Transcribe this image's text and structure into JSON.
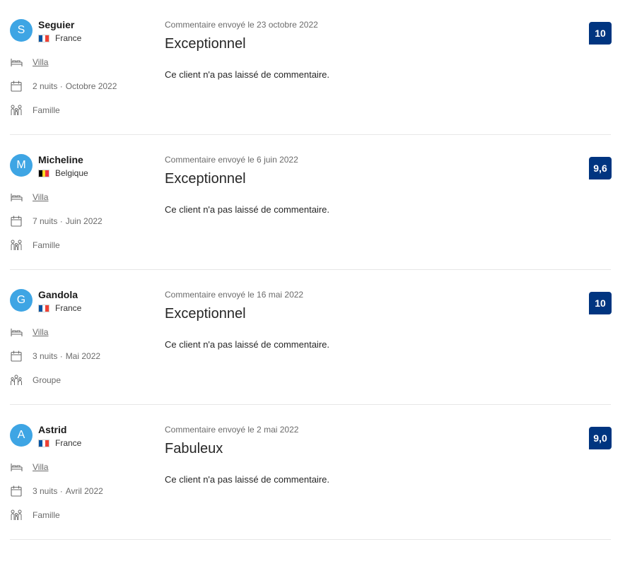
{
  "reviews": [
    {
      "initial": "S",
      "name": "Seguier",
      "country": "France",
      "room": "Villa",
      "nights": "2 nuits ·",
      "month": "Octobre 2022",
      "traveler_type": "Famille",
      "date": "Commentaire envoyé le 23 octobre 2022",
      "title": "Exceptionnel",
      "body": "Ce client n'a pas laissé de commentaire.",
      "score": "10",
      "flag_colors": [
        "#0055a4",
        "#ffffff",
        "#ef4135"
      ]
    },
    {
      "initial": "M",
      "name": "Micheline",
      "country": "Belgique",
      "room": "Villa",
      "nights": "7 nuits ·",
      "month": "Juin 2022",
      "traveler_type": "Famille",
      "date": "Commentaire envoyé le 6 juin 2022",
      "title": "Exceptionnel",
      "body": "Ce client n'a pas laissé de commentaire.",
      "score": "9,6",
      "flag_colors": [
        "#000000",
        "#fdda24",
        "#ef3340"
      ]
    },
    {
      "initial": "G",
      "name": "Gandola",
      "country": "France",
      "room": "Villa",
      "nights": "3 nuits ·",
      "month": "Mai 2022",
      "traveler_type": "Groupe",
      "date": "Commentaire envoyé le 16 mai 2022",
      "title": "Exceptionnel",
      "body": "Ce client n'a pas laissé de commentaire.",
      "score": "10",
      "flag_colors": [
        "#0055a4",
        "#ffffff",
        "#ef4135"
      ]
    },
    {
      "initial": "A",
      "name": "Astrid",
      "country": "France",
      "room": "Villa",
      "nights": "3 nuits ·",
      "month": "Avril 2022",
      "traveler_type": "Famille",
      "date": "Commentaire envoyé le 2 mai 2022",
      "title": "Fabuleux",
      "body": "Ce client n'a pas laissé de commentaire.",
      "score": "9,0",
      "flag_colors": [
        "#0055a4",
        "#ffffff",
        "#ef4135"
      ]
    }
  ],
  "icons": {
    "room": "bed-icon",
    "stay": "calendar-icon",
    "family": "family-icon",
    "group": "group-icon"
  },
  "colors": {
    "avatar": "#3ea5e4",
    "score_badge": "#003580"
  }
}
